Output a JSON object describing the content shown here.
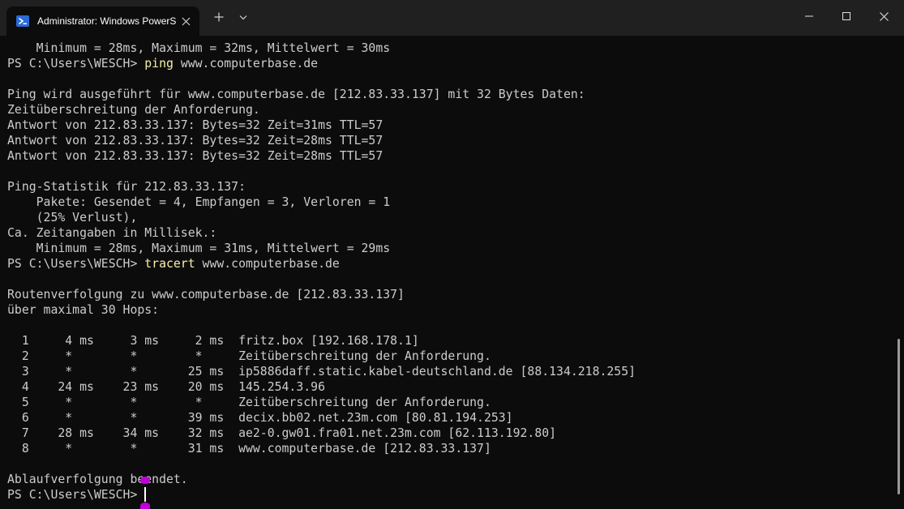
{
  "titlebar": {
    "tab_title": "Administrator: Windows PowerShell",
    "tab_icon": "powershell-icon",
    "close_tab_icon": "close-icon",
    "new_tab_label": "+",
    "dropdown_icon": "chevron-down-icon",
    "minimize_icon": "minimize-icon",
    "maximize_icon": "maximize-icon",
    "close_window_icon": "close-icon"
  },
  "colors": {
    "background": "#0c0c0c",
    "text": "#cccccc",
    "command": "#f9f1a5",
    "titlebar": "#202020",
    "marker": "#c000d8"
  },
  "terminal": {
    "lines": [
      {
        "text": "    Minimum = 28ms, Maximum = 32ms, Mittelwert = 30ms"
      },
      {
        "prompt": "PS C:\\Users\\WESCH> ",
        "cmd": "ping",
        "args": " www.computerbase.de"
      },
      {
        "text": ""
      },
      {
        "text": "Ping wird ausgeführt für www.computerbase.de [212.83.33.137] mit 32 Bytes Daten:"
      },
      {
        "text": "Zeitüberschreitung der Anforderung."
      },
      {
        "text": "Antwort von 212.83.33.137: Bytes=32 Zeit=31ms TTL=57"
      },
      {
        "text": "Antwort von 212.83.33.137: Bytes=32 Zeit=28ms TTL=57"
      },
      {
        "text": "Antwort von 212.83.33.137: Bytes=32 Zeit=28ms TTL=57"
      },
      {
        "text": ""
      },
      {
        "text": "Ping-Statistik für 212.83.33.137:"
      },
      {
        "text": "    Pakete: Gesendet = 4, Empfangen = 3, Verloren = 1"
      },
      {
        "text": "    (25% Verlust),"
      },
      {
        "text": "Ca. Zeitangaben in Millisek.:"
      },
      {
        "text": "    Minimum = 28ms, Maximum = 31ms, Mittelwert = 29ms"
      },
      {
        "prompt": "PS C:\\Users\\WESCH> ",
        "cmd": "tracert",
        "args": " www.computerbase.de"
      },
      {
        "text": ""
      },
      {
        "text": "Routenverfolgung zu www.computerbase.de [212.83.33.137]"
      },
      {
        "text": "über maximal 30 Hops:"
      },
      {
        "text": ""
      },
      {
        "text": "  1     4 ms     3 ms     2 ms  fritz.box [192.168.178.1]"
      },
      {
        "text": "  2     *        *        *     Zeitüberschreitung der Anforderung."
      },
      {
        "text": "  3     *        *       25 ms  ip5886daff.static.kabel-deutschland.de [88.134.218.255]"
      },
      {
        "text": "  4    24 ms    23 ms    20 ms  145.254.3.96"
      },
      {
        "text": "  5     *        *        *     Zeitüberschreitung der Anforderung."
      },
      {
        "text": "  6     *        *       39 ms  decix.bb02.net.23m.com [80.81.194.253]"
      },
      {
        "text": "  7    28 ms    34 ms    32 ms  ae2-0.gw01.fra01.net.23m.com [62.113.192.80]"
      },
      {
        "text": "  8     *        *       31 ms  www.computerbase.de [212.83.33.137]"
      },
      {
        "text": ""
      },
      {
        "text": "Ablaufverfolgung beendet."
      },
      {
        "prompt": "PS C:\\Users\\WESCH> ",
        "cmd": "",
        "args": ""
      }
    ]
  }
}
